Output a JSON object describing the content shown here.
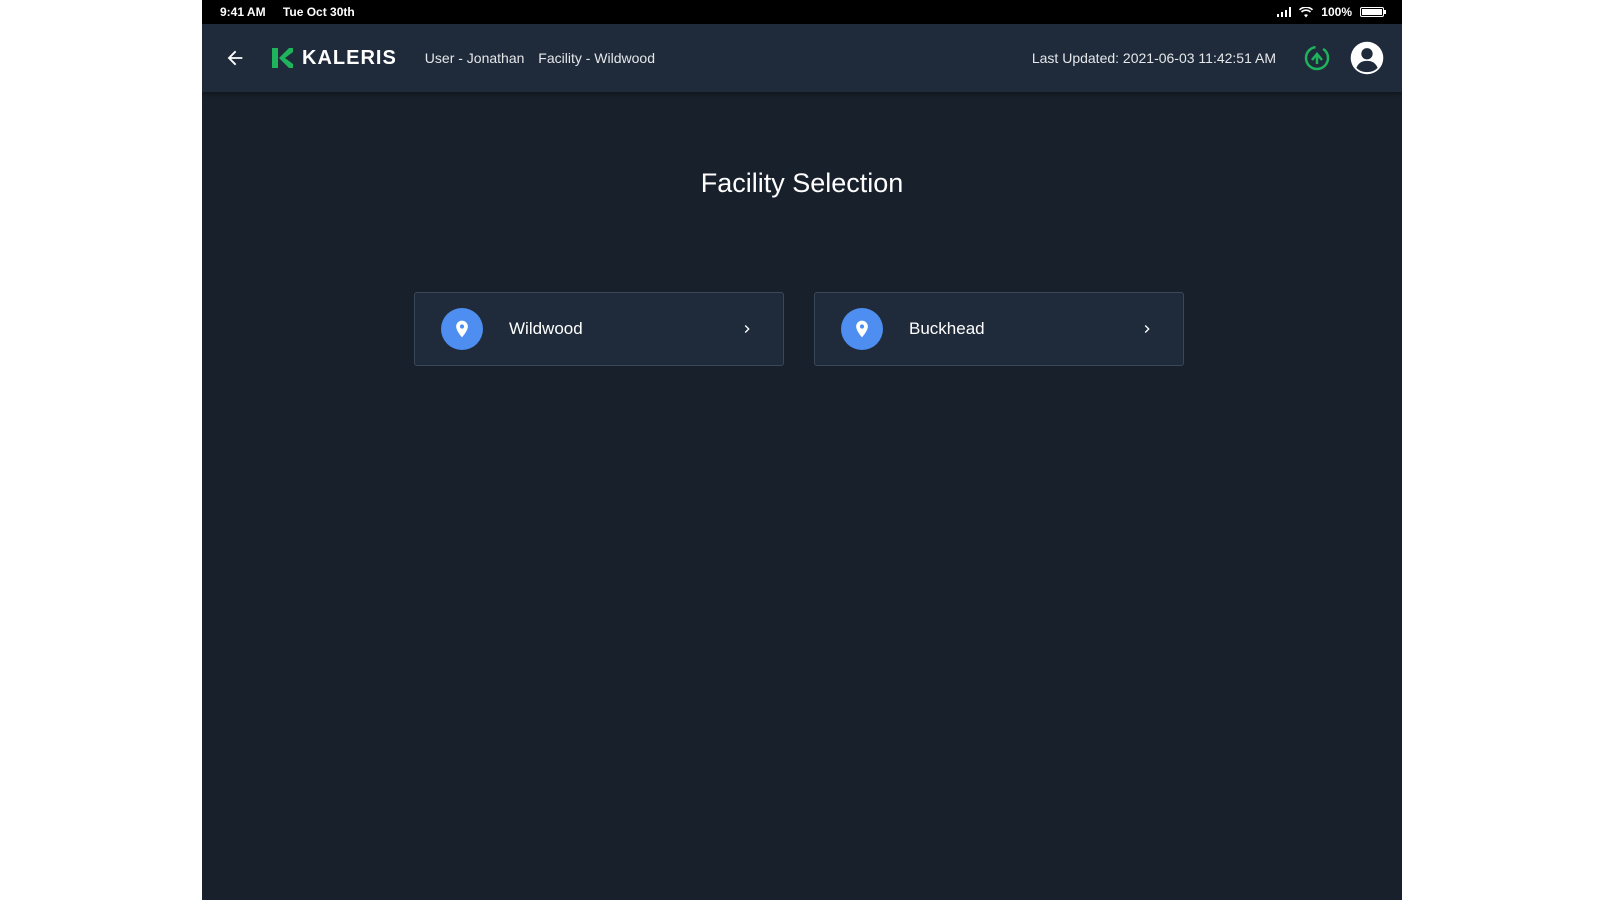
{
  "status_bar": {
    "time": "9:41 AM",
    "date": "Tue Oct 30th",
    "battery": "100%"
  },
  "header": {
    "brand": "KALERIS",
    "user": "User - Jonathan",
    "facility": "Facility - Wildwood",
    "last_updated": "Last Updated: 2021-06-03 11:42:51 AM"
  },
  "main": {
    "title": "Facility Selection",
    "facilities": [
      {
        "label": "Wildwood"
      },
      {
        "label": "Buckhead"
      }
    ]
  },
  "colors": {
    "background": "#18202b",
    "app_bar": "#1f2b3a",
    "brand_green": "#1fb35c",
    "pin_blue": "#4d8ef0",
    "sync_green": "#1fb35c"
  },
  "icons": {
    "back": "arrow-left-icon",
    "logo": "kaleris-logo-icon",
    "sync": "sync-status-icon",
    "avatar": "account-circle-icon",
    "pin": "location-pin-icon",
    "chevron": "chevron-right-icon"
  }
}
